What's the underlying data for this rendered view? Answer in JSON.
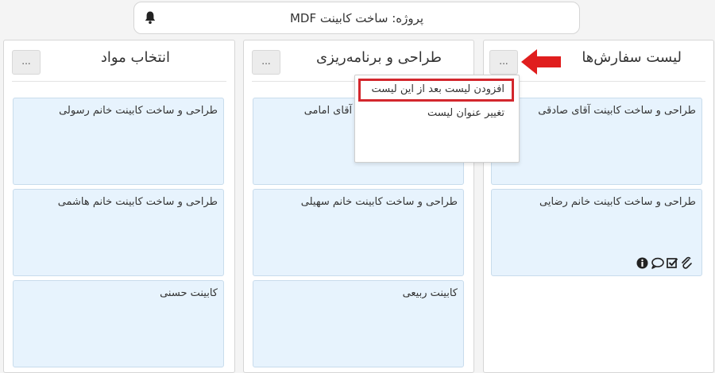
{
  "header": {
    "title": "پروژه: ساخت کابینت MDF",
    "notification_icon": "bell-icon"
  },
  "colors": {
    "card_bg": "#e7f3fd",
    "highlight": "#d3272d",
    "arrow": "#e01e1e"
  },
  "columns": [
    {
      "title": "لیست سفارش‌ها",
      "menu_label": "...",
      "cards": [
        {
          "title": "طراحی و ساخت کابینت آقای صادقی"
        },
        {
          "title": "طراحی و ساخت کابینت خانم رضایی",
          "icons": [
            "attachment-icon",
            "checklist-icon",
            "comment-icon",
            "info-icon"
          ]
        }
      ]
    },
    {
      "title": "طراحی و برنامه‌ریزی",
      "menu_label": "...",
      "cards": [
        {
          "title": "طراحی و ساخت کابینت آقای امامی"
        },
        {
          "title": "طراحی و ساخت کابینت خانم سهیلی"
        },
        {
          "title": "کابینت ربیعی"
        }
      ]
    },
    {
      "title": "انتخاب مواد",
      "menu_label": "...",
      "cards": [
        {
          "title": "طراحی و ساخت کابینت خانم رسولی"
        },
        {
          "title": "طراحی و ساخت کابینت خانم هاشمی"
        },
        {
          "title": "کابینت حسنی"
        }
      ]
    }
  ],
  "dropdown": {
    "items": [
      {
        "label": "افزودن لیست بعد از این لیست"
      },
      {
        "label": "تغییر عنوان لیست"
      }
    ]
  }
}
